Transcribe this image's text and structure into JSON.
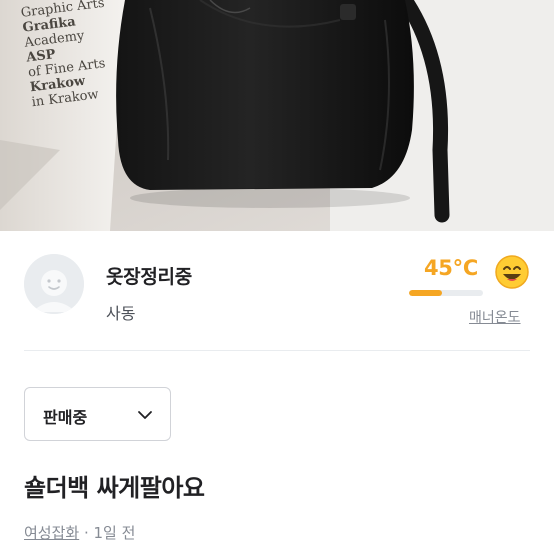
{
  "photo": {
    "poster_lines": [
      "Graphic Arts",
      "Grafika",
      "Academy",
      "ASP",
      "of Fine Arts",
      "Krakow",
      "in Krakow"
    ],
    "subject": "black shoulder bag"
  },
  "seller": {
    "nickname": "옷장정리중",
    "region": "사동",
    "avatar_icon": "default-profile-avatar-icon"
  },
  "manner": {
    "temperature_text": "45°C",
    "temperature_value": 45,
    "bar_fill_percent": 45,
    "emoji_icon": "smiling-face-emoji-icon",
    "link_label": "매너온도",
    "color": "#f5a623"
  },
  "status_dropdown": {
    "selected": "판매중",
    "chevron_icon": "chevron-down-icon"
  },
  "post": {
    "title": "숄더백 싸게팔아요",
    "category": "여성잡화",
    "separator": " · ",
    "time": "1일 전"
  }
}
